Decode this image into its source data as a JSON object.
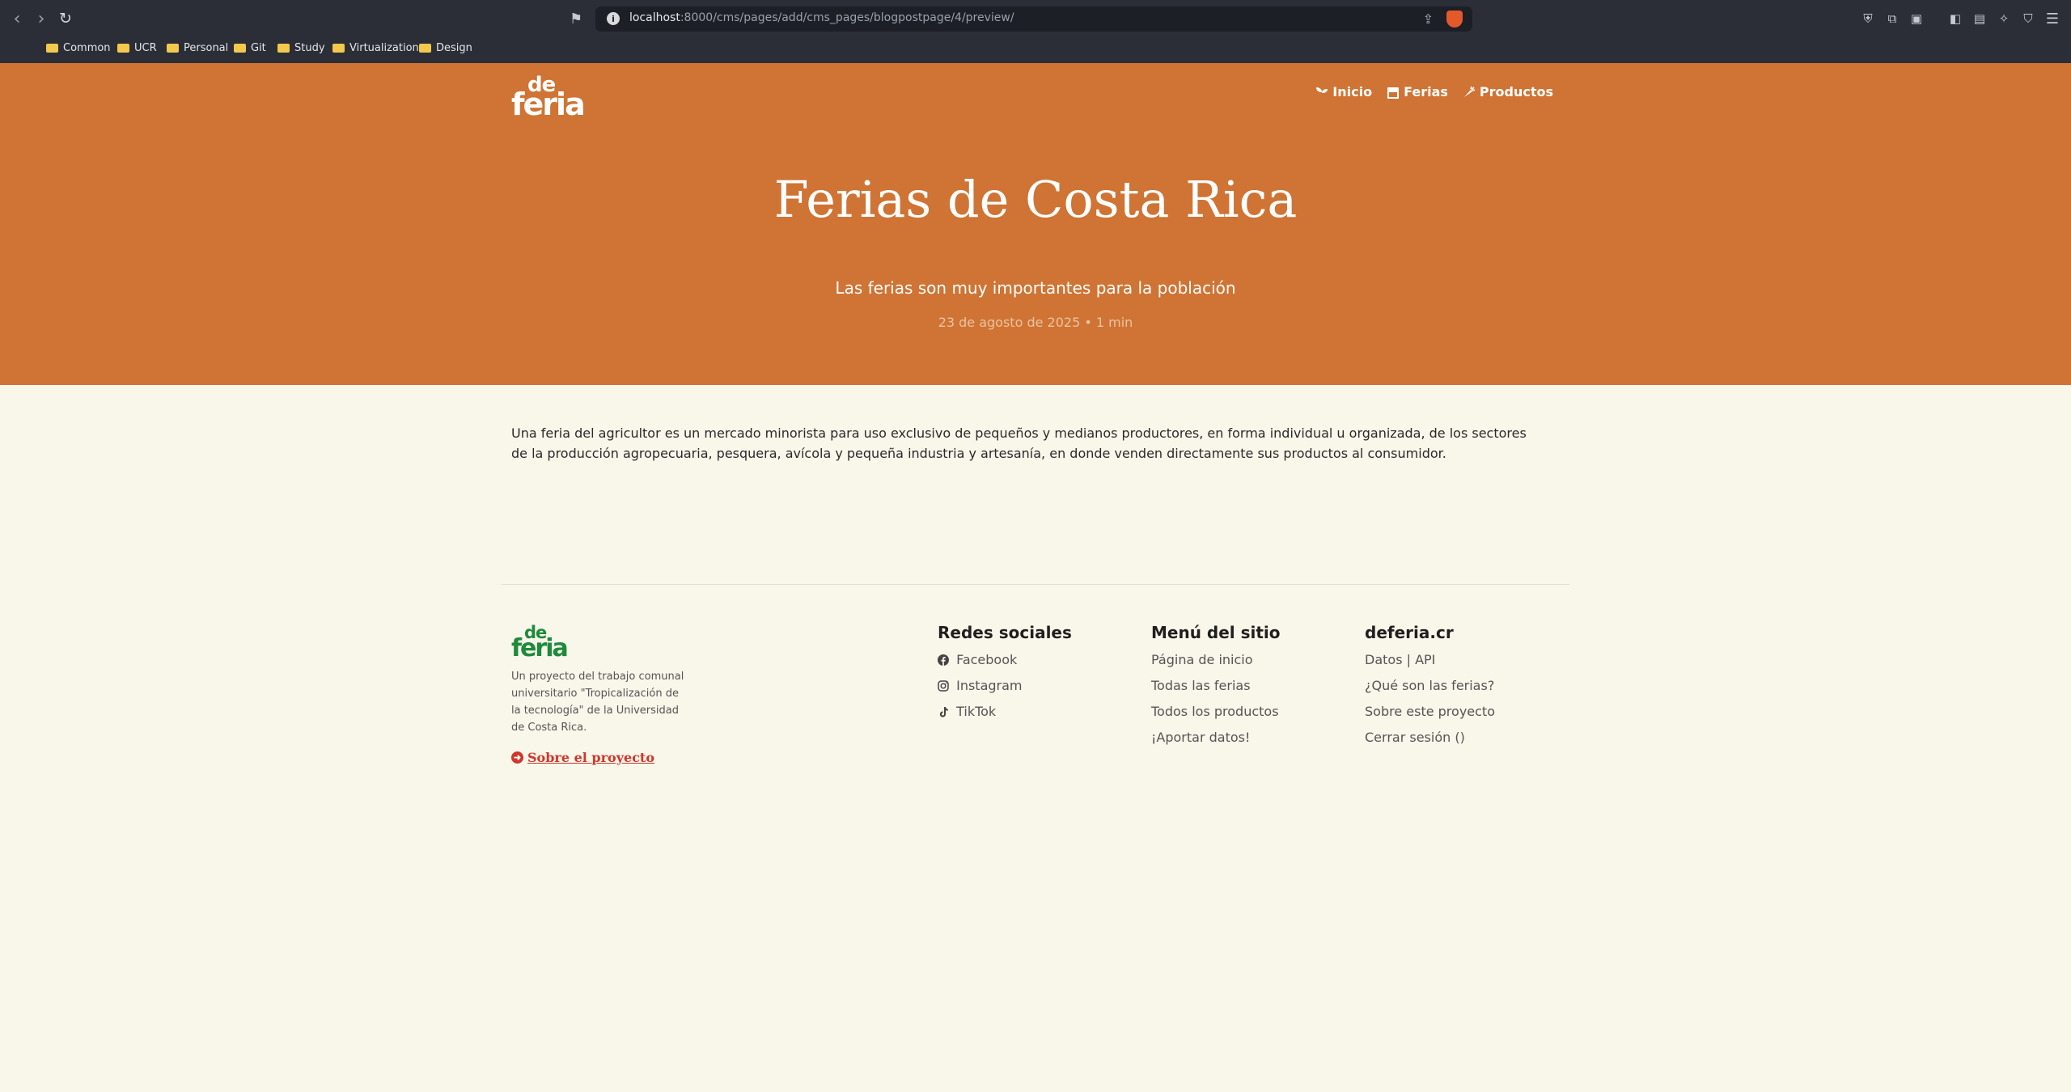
{
  "browser": {
    "url_host": "localhost",
    "url_rest": ":8000/cms/pages/add/cms_pages/blogpostpage/4/preview/",
    "bookmarks": [
      "Common",
      "UCR",
      "Personal",
      "Git",
      "Study",
      "Virtualization",
      "Design"
    ]
  },
  "site": {
    "logo_top": "de",
    "logo_bottom": "feria",
    "nav": {
      "inicio": "Inicio",
      "ferias": "Ferias",
      "productos": "Productos"
    }
  },
  "hero": {
    "title": "Ferias de Costa Rica",
    "subtitle": "Las ferias son muy importantes para la población",
    "meta": "23 de agosto de 2025 • 1 min"
  },
  "article": {
    "body": "Una feria del agricultor es un mercado minorista para uso exclusivo de pequeños y medianos productores, en forma individual u organizada, de los sectores de la producción agropecuaria, pesquera, avícola y pequeña industria y artesanía, en donde venden directamente sus productos al consumidor."
  },
  "footer": {
    "logo_top": "de",
    "logo_bottom": "feria",
    "description": "Un proyecto del trabajo comunal universitario \"Tropicalización de la tecnología\" de la Universidad de Costa Rica.",
    "about_link": "Sobre el proyecto",
    "social": {
      "title": "Redes sociales",
      "links": [
        "Facebook",
        "Instagram",
        "TikTok"
      ]
    },
    "menu": {
      "title": "Menú del sitio",
      "links": [
        "Página de inicio",
        "Todas las ferias",
        "Todos los productos",
        "¡Aportar datos!"
      ]
    },
    "site": {
      "title": "deferia.cr",
      "links": [
        "Datos | API",
        "¿Qué son las ferias?",
        "Sobre este proyecto",
        "Cerrar sesión ()"
      ]
    }
  },
  "colors": {
    "brand_orange": "#cf7434",
    "brand_green": "#1e8a3c",
    "accent_red": "#d2352a",
    "page_bg": "#f9f6ea"
  }
}
